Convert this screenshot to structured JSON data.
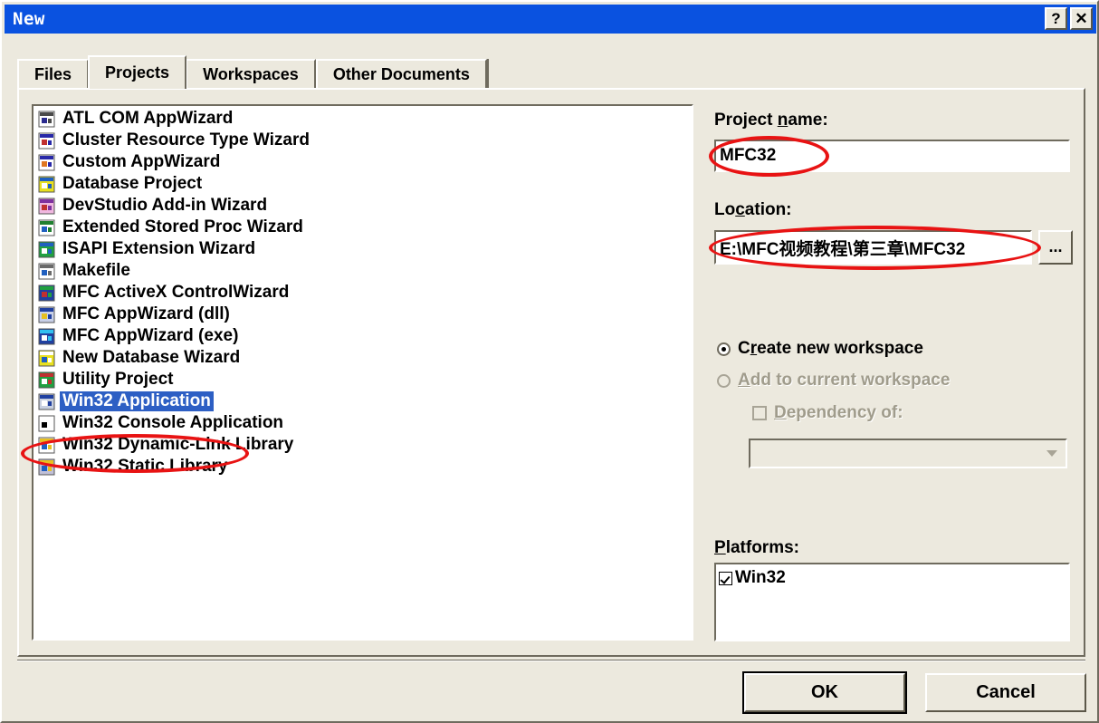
{
  "window": {
    "title": "New",
    "help_button": "?",
    "close_button": "✕"
  },
  "tabs": [
    {
      "label": "Files",
      "selected": false
    },
    {
      "label": "Projects",
      "selected": true
    },
    {
      "label": "Workspaces",
      "selected": false
    },
    {
      "label": "Other Documents",
      "selected": false
    }
  ],
  "project_types": [
    {
      "label": "ATL COM AppWizard",
      "icon": "atl-com-appwizard-icon",
      "selected": false
    },
    {
      "label": "Cluster Resource Type Wizard",
      "icon": "cluster-resource-wizard-icon",
      "selected": false
    },
    {
      "label": "Custom AppWizard",
      "icon": "custom-appwizard-icon",
      "selected": false
    },
    {
      "label": "Database Project",
      "icon": "database-project-icon",
      "selected": false
    },
    {
      "label": "DevStudio Add-in Wizard",
      "icon": "devstudio-addin-wizard-icon",
      "selected": false
    },
    {
      "label": "Extended Stored Proc Wizard",
      "icon": "extended-stored-proc-icon",
      "selected": false
    },
    {
      "label": "ISAPI Extension Wizard",
      "icon": "isapi-extension-wizard-icon",
      "selected": false
    },
    {
      "label": "Makefile",
      "icon": "makefile-icon",
      "selected": false
    },
    {
      "label": "MFC ActiveX ControlWizard",
      "icon": "mfc-activex-control-icon",
      "selected": false
    },
    {
      "label": "MFC AppWizard (dll)",
      "icon": "mfc-appwizard-dll-icon",
      "selected": false
    },
    {
      "label": "MFC AppWizard (exe)",
      "icon": "mfc-appwizard-exe-icon",
      "selected": false
    },
    {
      "label": "New Database Wizard",
      "icon": "new-database-wizard-icon",
      "selected": false
    },
    {
      "label": "Utility Project",
      "icon": "utility-project-icon",
      "selected": false
    },
    {
      "label": "Win32 Application",
      "icon": "win32-application-icon",
      "selected": true
    },
    {
      "label": "Win32 Console Application",
      "icon": "win32-console-app-icon",
      "selected": false
    },
    {
      "label": "Win32 Dynamic-Link Library",
      "icon": "win32-dll-icon",
      "selected": false
    },
    {
      "label": "Win32 Static Library",
      "icon": "win32-static-lib-icon",
      "selected": false
    }
  ],
  "project_name": {
    "label_pre": "Project ",
    "label_accel": "n",
    "label_post": "ame:",
    "value": "MFC32"
  },
  "location": {
    "label_pre": "Lo",
    "label_accel": "c",
    "label_post": "ation:",
    "value": "E:\\MFC视频教程\\第三章\\MFC32",
    "browse_label": "..."
  },
  "workspace": {
    "create_new": {
      "label_pre": "C",
      "label_accel": "r",
      "label_post": "eate new workspace",
      "selected": true,
      "enabled": true
    },
    "add_current": {
      "label_pre": "",
      "label_accel": "A",
      "label_post": "dd to current workspace",
      "selected": false,
      "enabled": false
    },
    "dependency": {
      "label_pre": "",
      "label_accel": "D",
      "label_post": "ependency of:",
      "checked": false,
      "enabled": false,
      "combo_value": ""
    }
  },
  "platforms": {
    "label_pre": "",
    "label_accel": "P",
    "label_post": "latforms:",
    "items": [
      {
        "label": "Win32",
        "checked": true
      }
    ]
  },
  "footer": {
    "ok_label": "OK",
    "cancel_label": "Cancel"
  },
  "annotations": {
    "color": "#E81313",
    "marks": [
      "project-name-circle",
      "location-circle",
      "win32-application-circle"
    ]
  }
}
